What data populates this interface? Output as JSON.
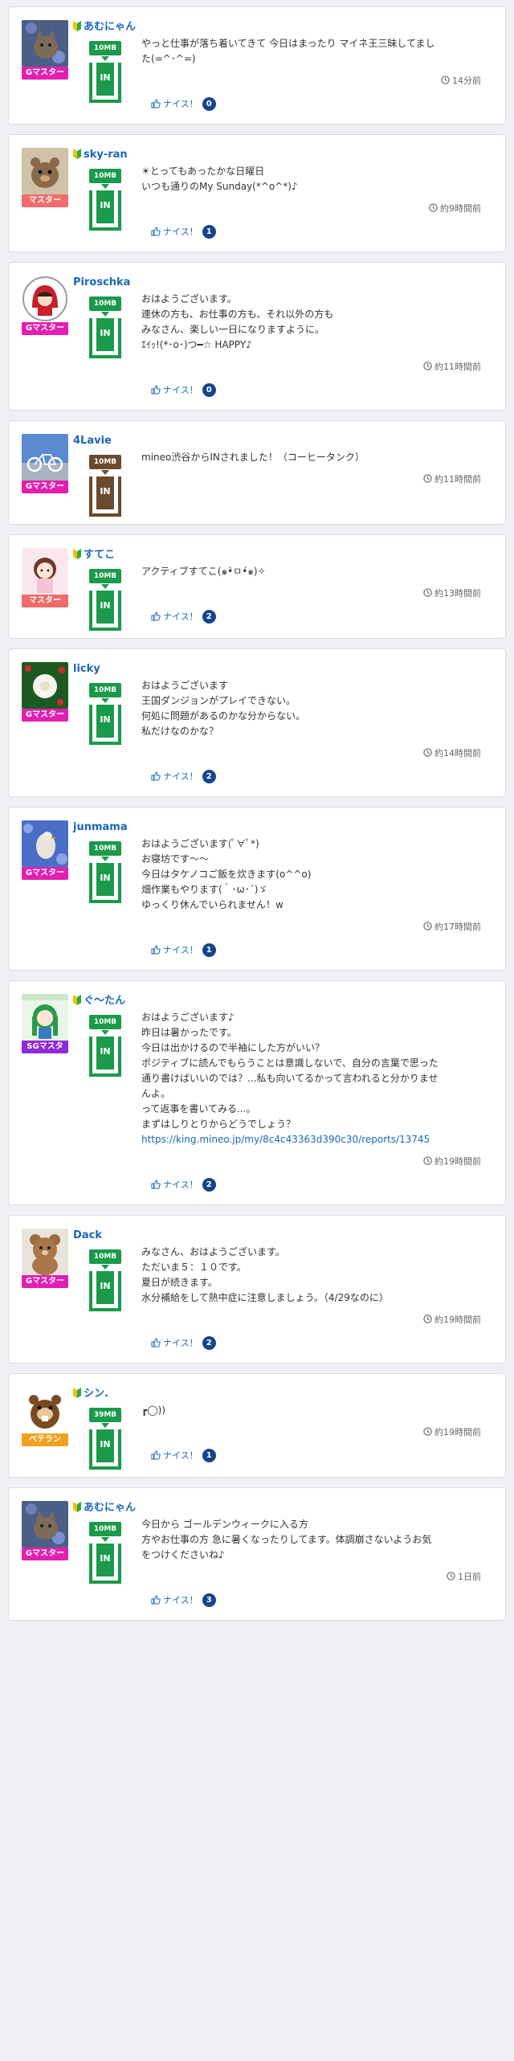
{
  "colors": {
    "link": "#1a66b8",
    "tank_green": "#1a9a4a",
    "tank_brown": "#6b4a2f",
    "nice_badge": "#14458c",
    "rank_gmaster": "#e31fb0",
    "rank_master": "#f06b6b",
    "rank_sgmaster": "#8f2bd6",
    "rank_veteran": "#f2a11f"
  },
  "icons": {
    "beginner": "beginner-mark-icon",
    "clock": "clock-icon",
    "thumb": "thumbs-up-icon"
  },
  "posts": [
    {
      "user": "あむにゃん",
      "beginner": true,
      "rank": "Gマスター",
      "rank_color": "#e31fb0",
      "avatar": "cat-photo",
      "tank_amount": "10MB",
      "tank_label": "IN",
      "tank_color": "#1a9a4a",
      "lines": [
        "やっと仕事が落ち着いてきて 今日はまったり マイネ王三昧してまし",
        "た(=^･^=)"
      ],
      "link": "",
      "time": "14分前",
      "nice_label": "ナイス！",
      "nice_count": "0"
    },
    {
      "user": "sky-ran",
      "beginner": true,
      "rank": "マスター",
      "rank_color": "#f06b6b",
      "avatar": "hamster-photo",
      "tank_amount": "10MB",
      "tank_label": "IN",
      "tank_color": "#1a9a4a",
      "lines": [
        "☀とってもあったかな日曜日",
        "いつも通りのMy Sunday(*^o^*)♪"
      ],
      "link": "",
      "time": "約9時間前",
      "nice_label": "ナイス！",
      "nice_count": "1"
    },
    {
      "user": "Piroschka",
      "beginner": false,
      "rank": "Gマスター",
      "rank_color": "#e31fb0",
      "avatar": "red-hood-illustration",
      "tank_amount": "10MB",
      "tank_label": "IN",
      "tank_color": "#1a9a4a",
      "lines": [
        "おはようございます。",
        "連休の方も、お仕事の方も、それ以外の方も",
        "みなさん、楽しい一日になりますように。",
        "ｴｲｯ!(*･o･)つ━☆ HAPPY♪"
      ],
      "link": "",
      "time": "約11時間前",
      "nice_label": "ナイス！",
      "nice_count": "0"
    },
    {
      "user": "4Lavie",
      "beginner": false,
      "rank": "Gマスター",
      "rank_color": "#e31fb0",
      "avatar": "bicycle-photo",
      "tank_amount": "10MB",
      "tank_label": "IN",
      "tank_color": "#6b4a2f",
      "lines": [
        "mineo渋谷からINされました！（コーヒータンク）"
      ],
      "link": "",
      "time": "約11時間前",
      "nice_label": "",
      "nice_count": ""
    },
    {
      "user": "すてこ",
      "beginner": true,
      "rank": "マスター",
      "rank_color": "#f06b6b",
      "avatar": "anime-girl-illustration",
      "tank_amount": "10MB",
      "tank_label": "IN",
      "tank_color": "#1a9a4a",
      "lines": [
        "アクティブすてこ(๑•̀ㅁ•́๑)✧"
      ],
      "link": "",
      "time": "約13時間前",
      "nice_label": "ナイス！",
      "nice_count": "2"
    },
    {
      "user": "licky",
      "beginner": false,
      "rank": "Gマスター",
      "rank_color": "#e31fb0",
      "avatar": "white-flower-photo",
      "tank_amount": "10MB",
      "tank_label": "IN",
      "tank_color": "#1a9a4a",
      "lines": [
        "おはようございます",
        "王国ダンジョンがプレイできない。",
        "何処に問題があるのかな分からない。",
        "私だけなのかな？"
      ],
      "link": "",
      "time": "約14時間前",
      "nice_label": "ナイス！",
      "nice_count": "2"
    },
    {
      "user": "junmama",
      "beginner": false,
      "rank": "Gマスター",
      "rank_color": "#e31fb0",
      "avatar": "bird-flowers-photo",
      "tank_amount": "10MB",
      "tank_label": "IN",
      "tank_color": "#1a9a4a",
      "lines": [
        "おはようございます(ﾟ∀ﾟ*)",
        "お寝坊です〜〜",
        "今日はタケノコご飯を炊きます(o^^o)",
        "畑作業もやります(｀･ω･´)ゞ",
        "ゆっくり休んでいられません！w"
      ],
      "link": "",
      "time": "約17時間前",
      "nice_label": "ナイス！",
      "nice_count": "1"
    },
    {
      "user": "ぐ〜たん",
      "beginner": true,
      "rank": "SGマスタ",
      "rank_color": "#8f2bd6",
      "avatar": "green-hair-girl-illustration",
      "tank_amount": "10MB",
      "tank_label": "IN",
      "tank_color": "#1a9a4a",
      "lines": [
        "おはようございます♪",
        "昨日は暑かったです。",
        "今日は出かけるので半袖にした方がいい？",
        "ポジティブに読んでもらうことは意識しないで、自分の言葉で思った",
        "通り書けばいいのでは？...私も向いてるかって言われると分かりませ",
        "んよ。",
        "って返事を書いてみる...。",
        "まずはしりとりからどうでしょう？"
      ],
      "link": "https://king.mineo.jp/my/8c4c43363d390c30/reports/13745",
      "time": "約19時間前",
      "nice_label": "ナイス！",
      "nice_count": "2"
    },
    {
      "user": "Dack",
      "beginner": false,
      "rank": "Gマスター",
      "rank_color": "#e31fb0",
      "avatar": "teddy-bear-photo",
      "tank_amount": "10MB",
      "tank_label": "IN",
      "tank_color": "#1a9a4a",
      "lines": [
        "みなさん、おはようございます。",
        "ただいま５：１０です。",
        "夏日が続きます。",
        "水分補給をして熱中症に注意しましょう。（4/29なのに）"
      ],
      "link": "",
      "time": "約19時間前",
      "nice_label": "ナイス！",
      "nice_count": "2"
    },
    {
      "user": "シン.",
      "beginner": true,
      "rank": "ベテラン",
      "rank_color": "#f2a11f",
      "avatar": "beaver-illustration",
      "tank_amount": "39MB",
      "tank_label": "IN",
      "tank_color": "#1a9a4a",
      "lines": [
        "┏◯))"
      ],
      "link": "",
      "time": "約19時間前",
      "nice_label": "ナイス！",
      "nice_count": "1"
    },
    {
      "user": "あむにゃん",
      "beginner": true,
      "rank": "Gマスター",
      "rank_color": "#e31fb0",
      "avatar": "cat-photo",
      "tank_amount": "10MB",
      "tank_label": "IN",
      "tank_color": "#1a9a4a",
      "lines": [
        "今日から ゴールデンウィークに入る方",
        "方やお仕事の方 急に暑くなったりしてます。体調崩さないようお気",
        "をつけくださいね♪"
      ],
      "link": "",
      "time": "1日前",
      "nice_label": "ナイス！",
      "nice_count": "3"
    }
  ]
}
